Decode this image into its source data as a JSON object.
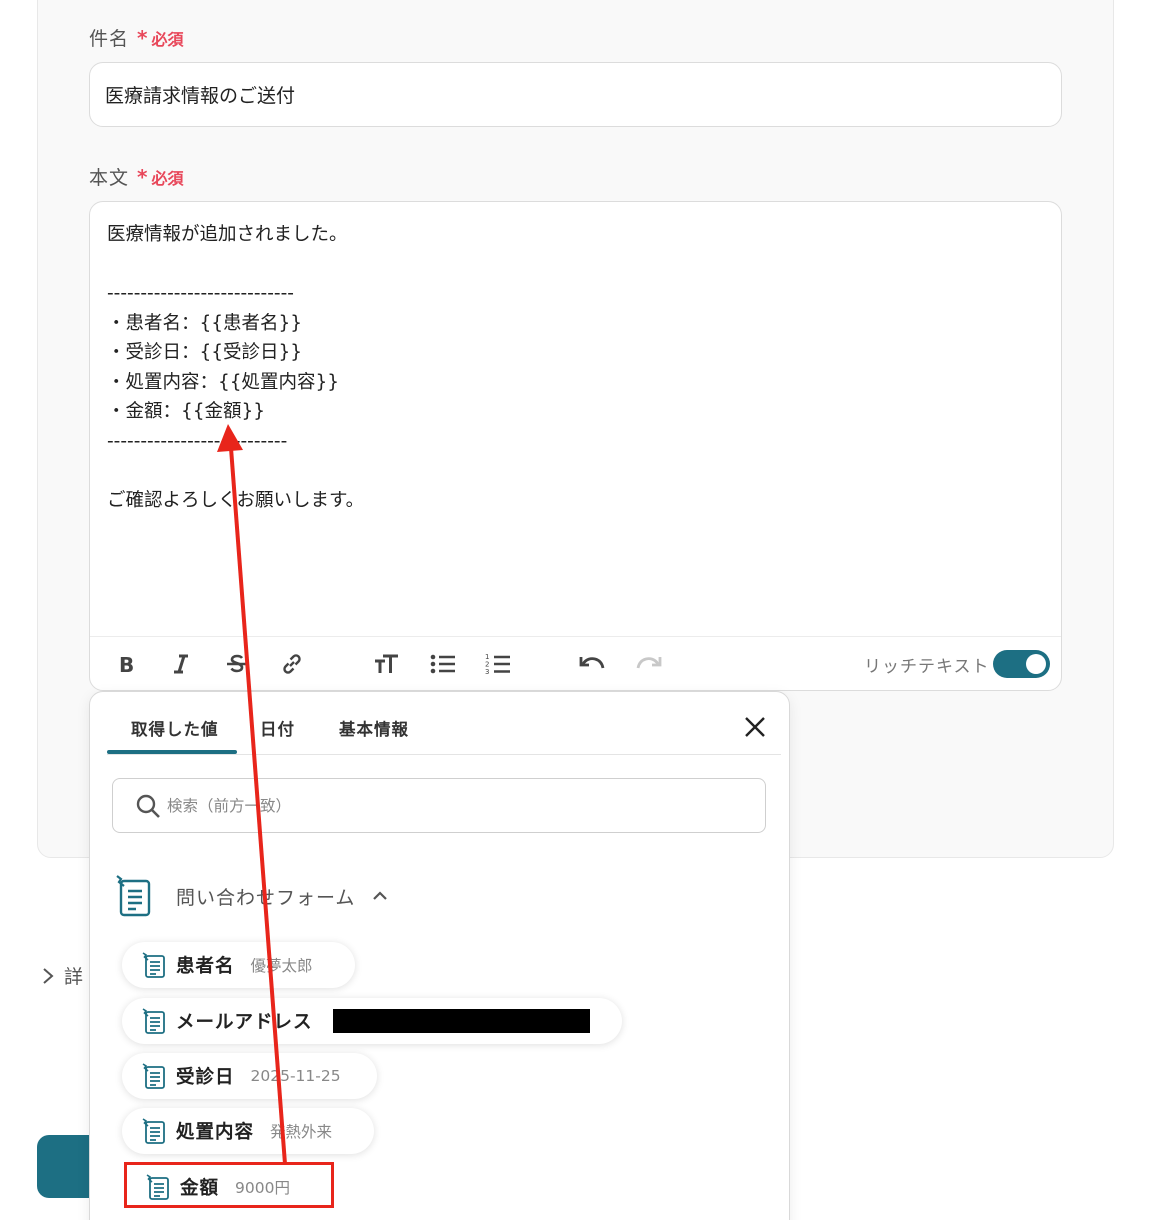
{
  "subject": {
    "label": "件名",
    "required_star": "*",
    "required_text": "必須",
    "value": "医療請求情報のご送付"
  },
  "body": {
    "label": "本文",
    "required_star": "*",
    "required_text": "必須",
    "lines": [
      "医療情報が追加されました。",
      "",
      "----------------------------",
      "・患者名：{{患者名}}",
      "・受診日：{{受診日}}",
      "・処置内容：{{処置内容}}",
      "・金額：{{金額}}",
      "---------------------------",
      "",
      "ご確認よろしくお願いします。"
    ]
  },
  "toolbar": {
    "icons": [
      "bold-icon",
      "italic-icon",
      "strikethrough-icon",
      "link-icon",
      "text-size-icon",
      "bullet-list-icon",
      "numbered-list-icon",
      "undo-icon",
      "redo-icon"
    ],
    "rich_text_label": "リッチテキスト",
    "rich_text_enabled": true
  },
  "popup": {
    "tabs": [
      {
        "label": "取得した値",
        "active": true
      },
      {
        "label": "日付",
        "active": false
      },
      {
        "label": "基本情報",
        "active": false
      }
    ],
    "search_placeholder": "検索（前方一致）",
    "group": {
      "label": "問い合わせフォーム",
      "expanded": true,
      "icon": "form-icon"
    },
    "items": [
      {
        "name": "患者名",
        "value": "優夢太郎"
      },
      {
        "name": "メールアドレス",
        "value": "",
        "redacted": true
      },
      {
        "name": "受診日",
        "value": "2025-11-25"
      },
      {
        "name": "処置内容",
        "value": "発熱外来"
      },
      {
        "name": "金額",
        "value": "9000円",
        "highlighted": true
      }
    ]
  },
  "details_toggle": {
    "label": "詳"
  },
  "colors": {
    "accent": "#1d6f83",
    "required": "#e8475a",
    "annotation": "#e8251b"
  }
}
